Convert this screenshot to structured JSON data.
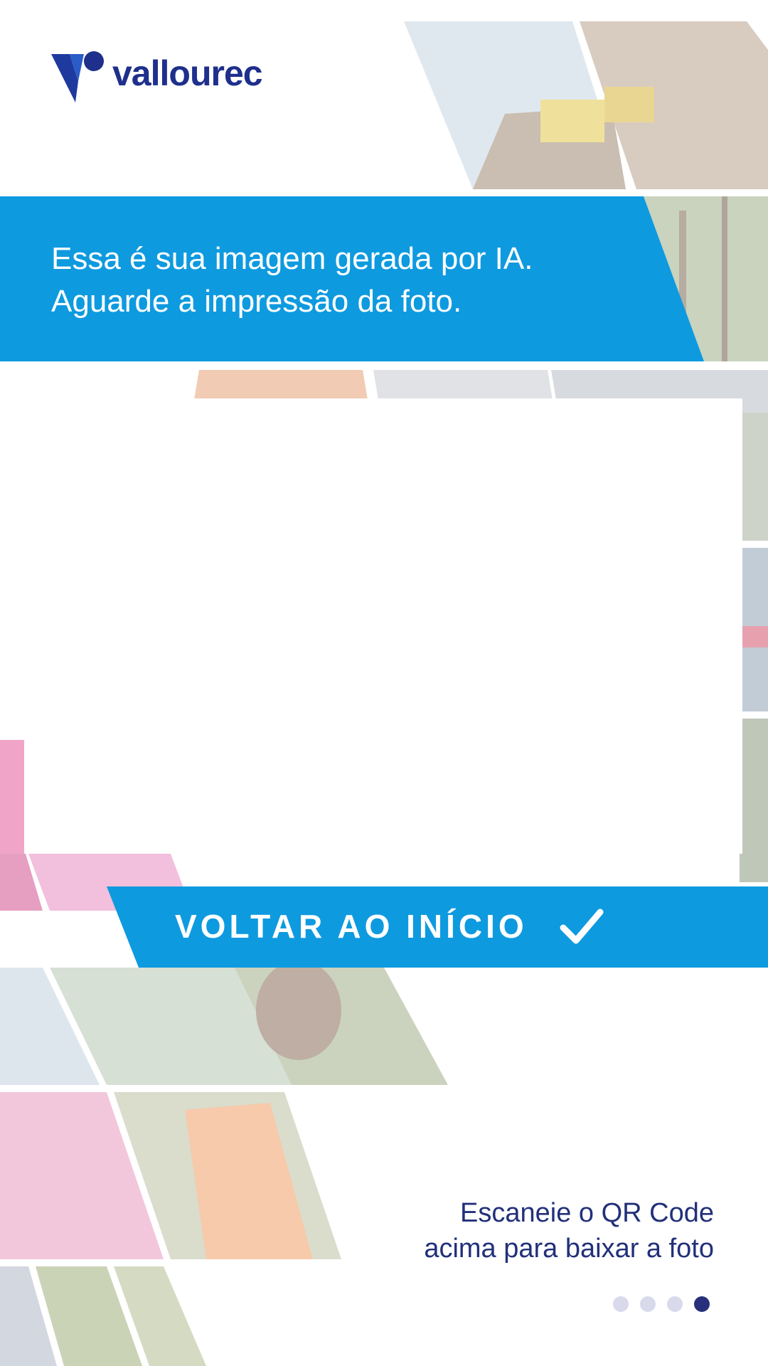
{
  "brand": {
    "name": "vallourec",
    "primary_color": "#1e2f8c",
    "accent_color": "#0e9adf"
  },
  "headline": {
    "line1": "Essa é sua imagem gerada por IA.",
    "line2": "Aguarde a impressão da foto."
  },
  "cta": {
    "label": "VOLTAR AO INÍCIO",
    "icon": "check-icon"
  },
  "qr_hint": {
    "line1": "Escaneie o QR Code",
    "line2": "acima para baixar a foto"
  },
  "pagination": {
    "total": 4,
    "current": 4
  }
}
